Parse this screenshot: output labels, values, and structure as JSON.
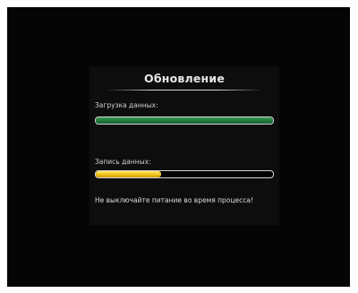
{
  "dialog": {
    "title": "Обновление",
    "download": {
      "label": "Загрузка данных:",
      "progress_fraction": 1.0,
      "color": "#1f7a3a"
    },
    "write": {
      "label": "Запись данных:",
      "progress_fraction": 0.37,
      "color": "#f2c414"
    },
    "warning": "Не выключайте питание во время процесса!"
  }
}
